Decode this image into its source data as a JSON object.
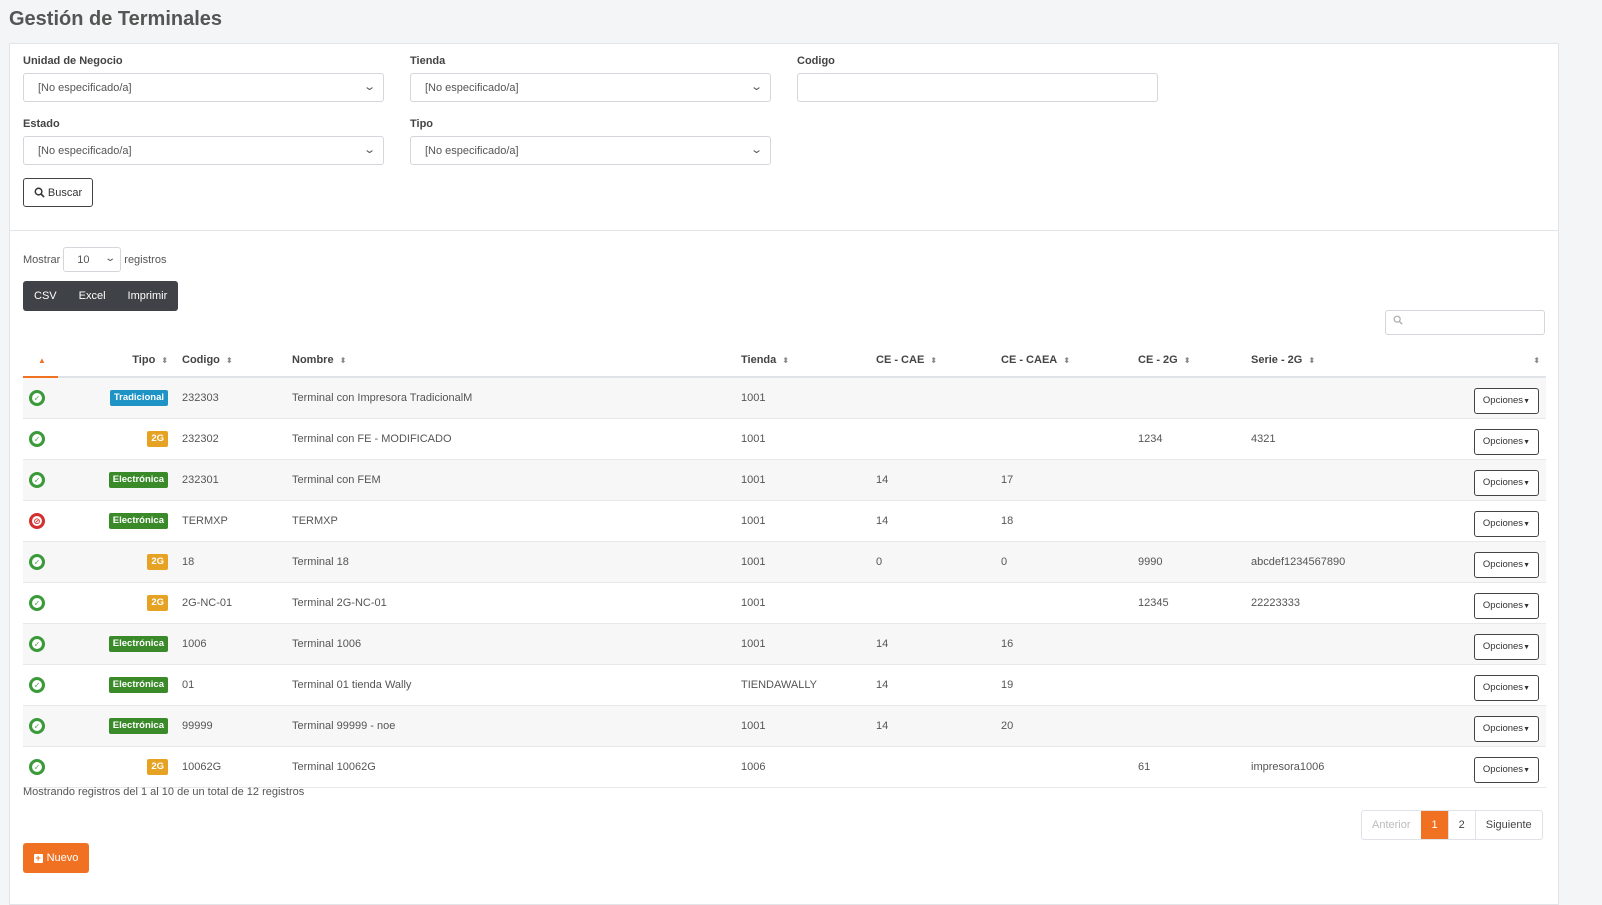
{
  "page": {
    "title": "Gestión de Terminales"
  },
  "filters": {
    "unidad": {
      "label": "Unidad de Negocio",
      "value": "[No especificado/a]"
    },
    "tienda": {
      "label": "Tienda",
      "value": "[No especificado/a]"
    },
    "codigo": {
      "label": "Codigo",
      "value": ""
    },
    "estado": {
      "label": "Estado",
      "value": "[No especificado/a]"
    },
    "tipo": {
      "label": "Tipo",
      "value": "[No especificado/a]"
    },
    "buscar_label": "Buscar"
  },
  "table_controls": {
    "mostrar": "Mostrar",
    "length": "10",
    "registros": "registros",
    "export": [
      "CSV",
      "Excel",
      "Imprimir"
    ]
  },
  "columns": [
    "",
    "Tipo",
    "Codigo",
    "Nombre",
    "Tienda",
    "CE - CAE",
    "CE - CAEA",
    "CE - 2G",
    "Serie - 2G",
    ""
  ],
  "rows": [
    {
      "status": "ok",
      "tipo": "Tradicional",
      "codigo": "232303",
      "nombre": "Terminal con Impresora TradicionalM",
      "tienda": "1001",
      "cae": "",
      "caea": "",
      "g2": "",
      "serie": "",
      "opciones": "Opciones"
    },
    {
      "status": "ok",
      "tipo": "2G",
      "codigo": "232302",
      "nombre": "Terminal con FE - MODIFICADO",
      "tienda": "1001",
      "cae": "",
      "caea": "",
      "g2": "1234",
      "serie": "4321",
      "opciones": "Opciones"
    },
    {
      "status": "ok",
      "tipo": "Electrónica",
      "codigo": "232301",
      "nombre": "Terminal con FEM",
      "tienda": "1001",
      "cae": "14",
      "caea": "17",
      "g2": "",
      "serie": "",
      "opciones": "Opciones"
    },
    {
      "status": "off",
      "tipo": "Electrónica",
      "codigo": "TERMXP",
      "nombre": "TERMXP",
      "tienda": "1001",
      "cae": "14",
      "caea": "18",
      "g2": "",
      "serie": "",
      "opciones": "Opciones"
    },
    {
      "status": "ok",
      "tipo": "2G",
      "codigo": "18",
      "nombre": "Terminal 18",
      "tienda": "1001",
      "cae": "0",
      "caea": "0",
      "g2": "9990",
      "serie": "abcdef1234567890",
      "opciones": "Opciones"
    },
    {
      "status": "ok",
      "tipo": "2G",
      "codigo": "2G-NC-01",
      "nombre": "Terminal 2G-NC-01",
      "tienda": "1001",
      "cae": "",
      "caea": "",
      "g2": "12345",
      "serie": "22223333",
      "opciones": "Opciones"
    },
    {
      "status": "ok",
      "tipo": "Electrónica",
      "codigo": "1006",
      "nombre": "Terminal 1006",
      "tienda": "1001",
      "cae": "14",
      "caea": "16",
      "g2": "",
      "serie": "",
      "opciones": "Opciones"
    },
    {
      "status": "ok",
      "tipo": "Electrónica",
      "codigo": "01",
      "nombre": "Terminal 01 tienda Wally",
      "tienda": "TIENDAWALLY",
      "cae": "14",
      "caea": "19",
      "g2": "",
      "serie": "",
      "opciones": "Opciones"
    },
    {
      "status": "ok",
      "tipo": "Electrónica",
      "codigo": "99999",
      "nombre": "Terminal 99999 - noe",
      "tienda": "1001",
      "cae": "14",
      "caea": "20",
      "g2": "",
      "serie": "",
      "opciones": "Opciones"
    },
    {
      "status": "ok",
      "tipo": "2G",
      "codigo": "10062G",
      "nombre": "Terminal 10062G",
      "tienda": "1006",
      "cae": "",
      "caea": "",
      "g2": "61",
      "serie": "impresora1006",
      "opciones": "Opciones"
    }
  ],
  "info": "Mostrando registros del 1 al 10 de un total de 12 registros",
  "pagination": {
    "prev": "Anterior",
    "pages": [
      "1",
      "2"
    ],
    "current": "1",
    "next": "Siguiente"
  },
  "nuevo_label": "Nuevo",
  "colors": {
    "accent": "#f07122",
    "ok": "#3a9a3a",
    "off": "#d32f2f",
    "tradicional": "#1d93c6",
    "g2": "#e6a323",
    "electronica": "#3a8a2a"
  }
}
